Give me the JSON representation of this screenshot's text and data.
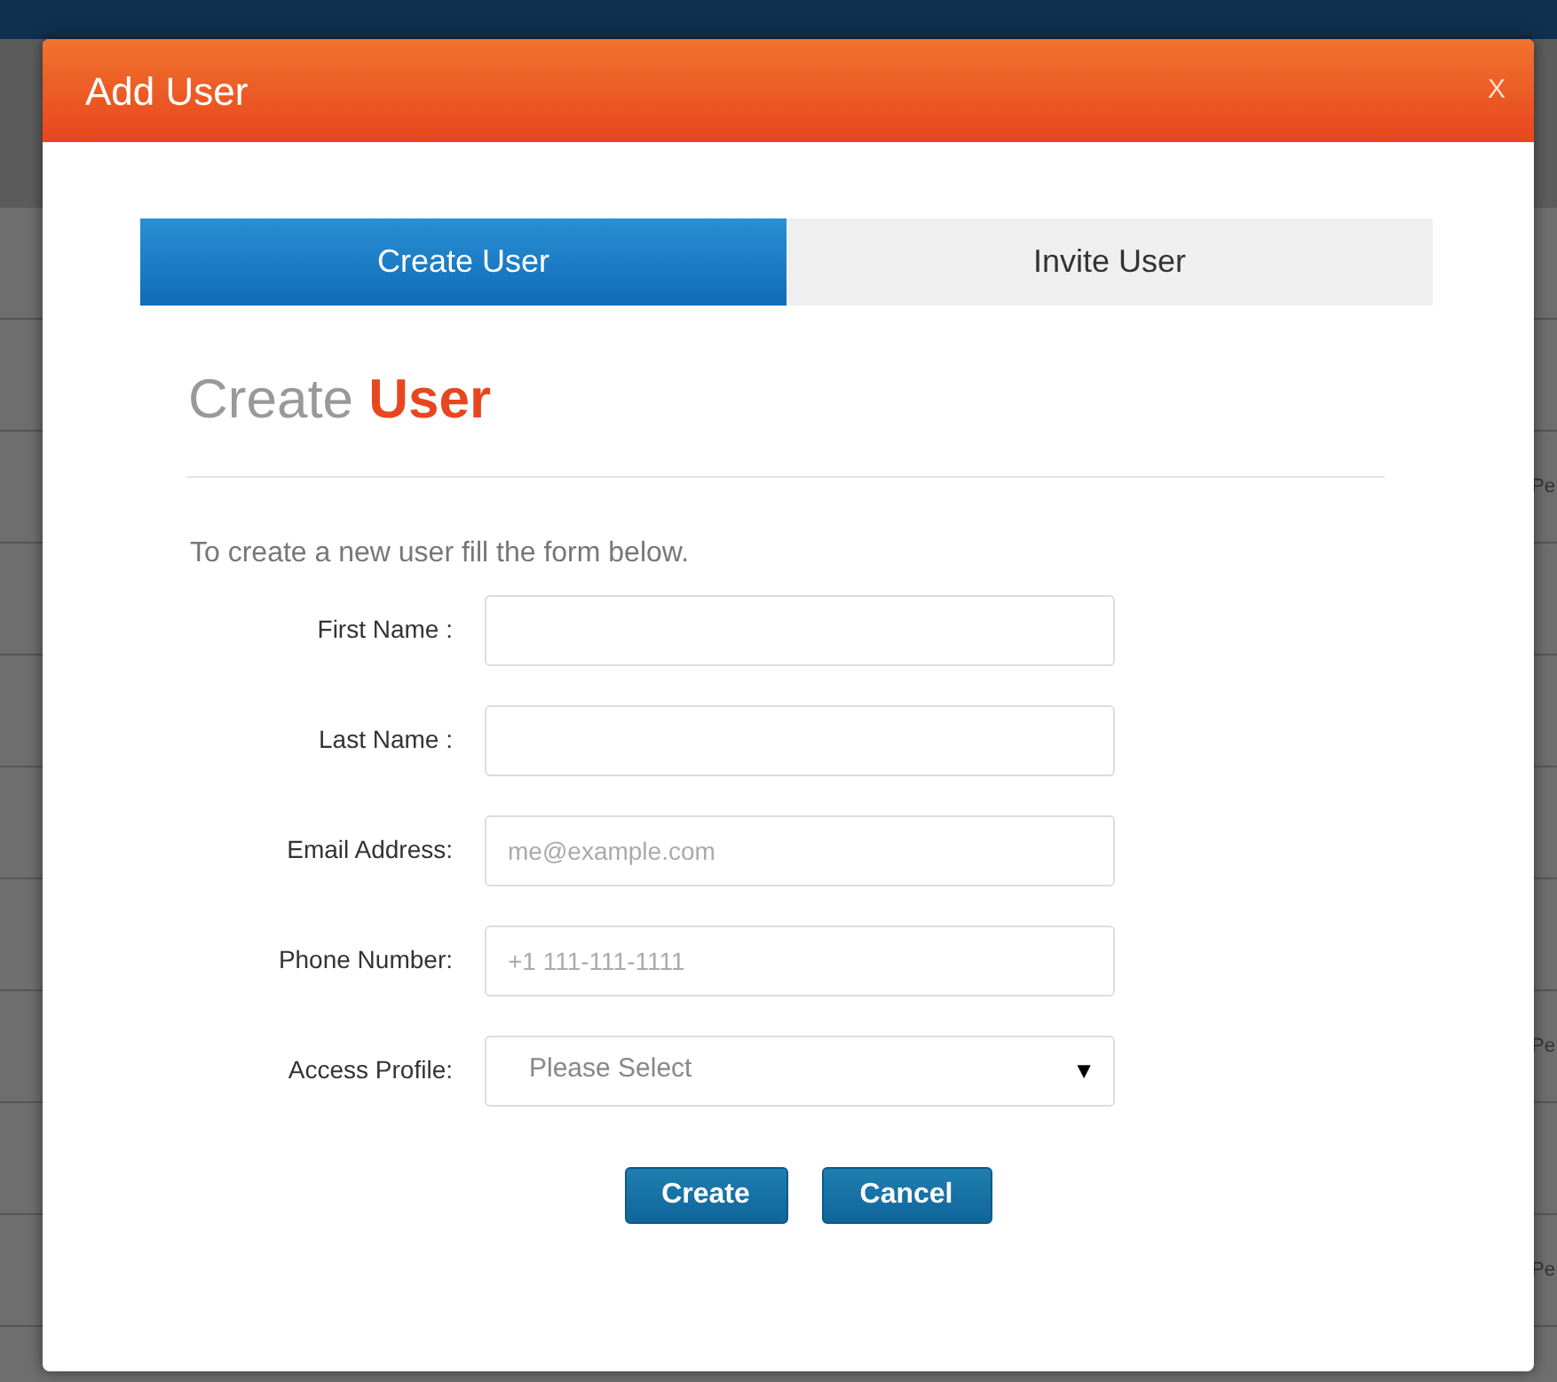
{
  "backdrop": {
    "row_texts": [
      {
        "text": "Pe"
      },
      {
        "text": "Pe"
      },
      {
        "text": "Pe"
      }
    ]
  },
  "dialog": {
    "title": "Add User",
    "close": "X",
    "tabs": [
      {
        "label": "Create User",
        "selected": true
      },
      {
        "label": "Invite User",
        "selected": false
      }
    ],
    "heading": "Create **User**",
    "intro": "To create a new user fill the form below.",
    "fields": [
      {
        "kind": "text",
        "label": "First Name :"
      },
      {
        "kind": "text",
        "label": "Last Name :"
      },
      {
        "kind": "text",
        "label": "Email Address:",
        "placeholder": "me@example.com"
      },
      {
        "kind": "text",
        "label": "Phone Number:",
        "placeholder": "+1 111-111-1111"
      },
      {
        "kind": "select",
        "label": "Access Profile:",
        "value": "Please Select",
        "caret": "▼"
      }
    ],
    "buttons": [
      "Create",
      "Cancel"
    ]
  }
}
